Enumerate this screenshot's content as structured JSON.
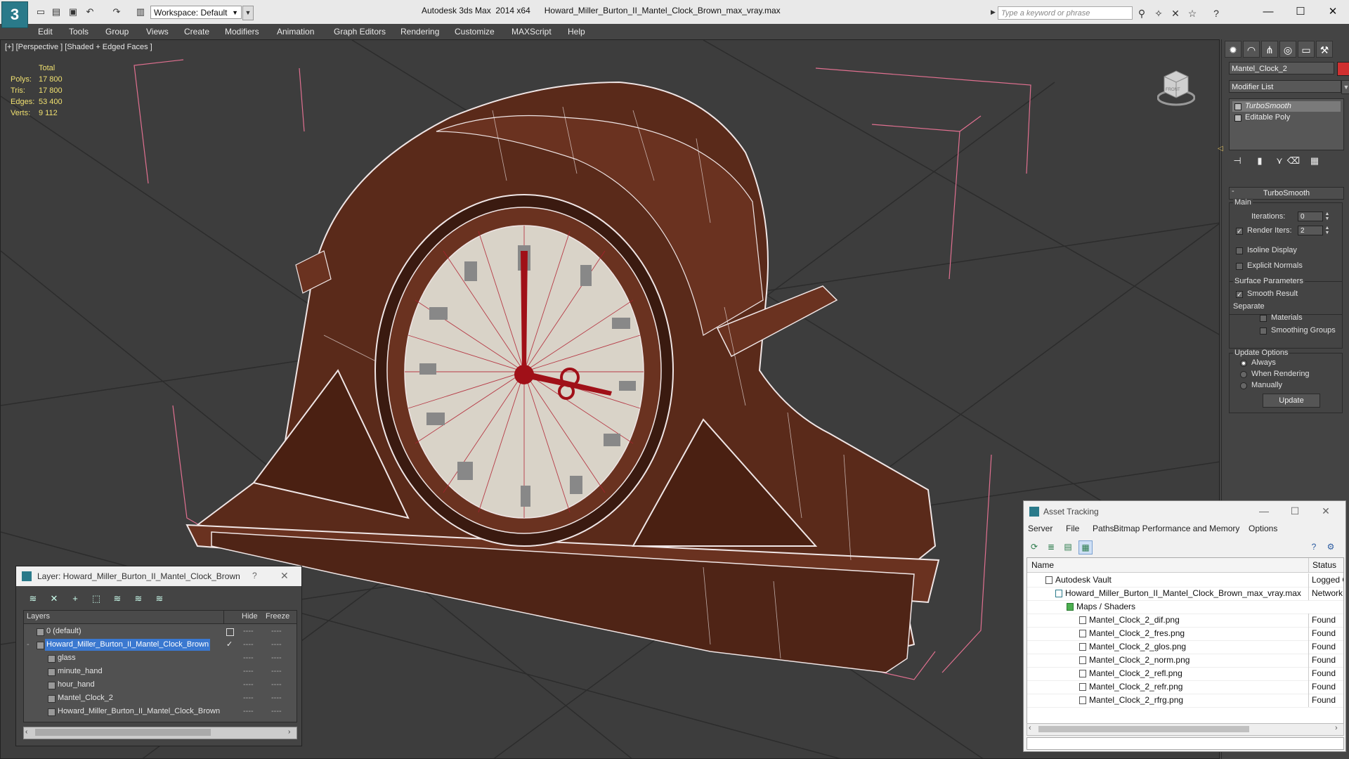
{
  "titlebar": {
    "workspace_label": "Workspace: Default",
    "title": "Autodesk 3ds Max  2014 x64      Howard_Miller_Burton_II_Mantel_Clock_Brown_max_vray.max",
    "search_placeholder": "Type a keyword or phrase",
    "app_icon": "3ds-max-logo-icon"
  },
  "menubar": {
    "items": [
      "Edit",
      "Tools",
      "Group",
      "Views",
      "Create",
      "Modifiers",
      "Animation",
      "Graph Editors",
      "Rendering",
      "Customize",
      "MAXScript",
      "Help"
    ]
  },
  "viewport": {
    "label": "[+] [Perspective ] [Shaded + Edged Faces ]",
    "stats": {
      "header": "Total",
      "rows": [
        {
          "label": "Polys:",
          "value": "17 800"
        },
        {
          "label": "Tris:",
          "value": "17 800"
        },
        {
          "label": "Edges:",
          "value": "53 400"
        },
        {
          "label": "Verts:",
          "value": "9 112"
        }
      ]
    },
    "viewcube_label": "FRONT"
  },
  "command_panel": {
    "object_name": "Mantel_Clock_2",
    "object_color": "#d03030",
    "modifier_list": "Modifier List",
    "stack": [
      "TurboSmooth",
      "Editable Poly"
    ],
    "rollout_title": "TurboSmooth",
    "main_label": "Main",
    "iterations_label": "Iterations:",
    "iterations_value": "0",
    "render_iters_label": "Render Iters:",
    "render_iters_value": "2",
    "isoline": "Isoline Display",
    "explicit_normals": "Explicit Normals",
    "surface_params": "Surface Parameters",
    "smooth_result": "Smooth Result",
    "separate": "Separate",
    "materials": "Materials",
    "smoothing_groups": "Smoothing Groups",
    "update_options": "Update Options",
    "always": "Always",
    "when_rendering": "When Rendering",
    "manually": "Manually",
    "update_button": "Update"
  },
  "layer_window": {
    "title": "Layer: Howard_Miller_Burton_II_Mantel_Clock_Brown",
    "help": "?",
    "close": "✕",
    "columns": {
      "layers": "Layers",
      "hide": "Hide",
      "freeze": "Freeze"
    },
    "rows": [
      {
        "name": "0 (default)",
        "indent": 0
      },
      {
        "name": "Howard_Miller_Burton_II_Mantel_Clock_Brown",
        "indent": 0
      },
      {
        "name": "glass",
        "indent": 1
      },
      {
        "name": "minute_hand",
        "indent": 1
      },
      {
        "name": "hour_hand",
        "indent": 1
      },
      {
        "name": "Mantel_Clock_2",
        "indent": 1
      },
      {
        "name": "Howard_Miller_Burton_II_Mantel_Clock_Brown",
        "indent": 1
      }
    ],
    "dash": "----"
  },
  "asset_window": {
    "title": "Asset Tracking",
    "menus": [
      "Server",
      "File",
      "Paths",
      "Bitmap Performance and Memory",
      "Options"
    ],
    "columns": {
      "name": "Name",
      "status": "Status"
    },
    "rows": [
      {
        "name": "Autodesk Vault",
        "status": "Logged O",
        "indent": 1
      },
      {
        "name": "Howard_Miller_Burton_II_Mantel_Clock_Brown_max_vray.max",
        "status": "Network",
        "indent": 2
      },
      {
        "name": "Maps / Shaders",
        "status": "",
        "indent": 3
      },
      {
        "name": "Mantel_Clock_2_dif.png",
        "status": "Found",
        "indent": 4
      },
      {
        "name": "Mantel_Clock_2_fres.png",
        "status": "Found",
        "indent": 4
      },
      {
        "name": "Mantel_Clock_2_glos.png",
        "status": "Found",
        "indent": 4
      },
      {
        "name": "Mantel_Clock_2_norm.png",
        "status": "Found",
        "indent": 4
      },
      {
        "name": "Mantel_Clock_2_refl.png",
        "status": "Found",
        "indent": 4
      },
      {
        "name": "Mantel_Clock_2_refr.png",
        "status": "Found",
        "indent": 4
      },
      {
        "name": "Mantel_Clock_2_rfrg.png",
        "status": "Found",
        "indent": 4
      }
    ]
  },
  "colors": {
    "viewport_bg": "#3d3d3d",
    "wood": "#5a2a1a",
    "selection": "#3a78d0",
    "stats_text": "#f0e070",
    "bbox_pink": "#e07090"
  }
}
